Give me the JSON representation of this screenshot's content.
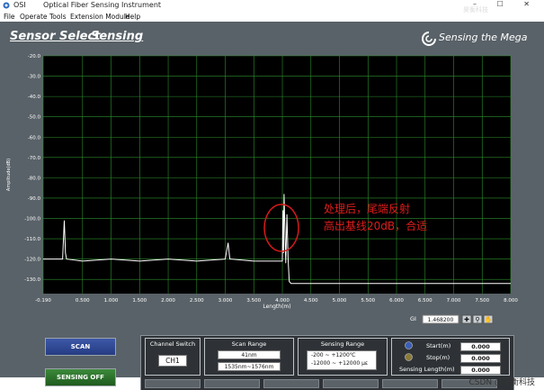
{
  "window": {
    "title_short": "OSI",
    "title": "Optical Fiber Sensing Instrument",
    "window_controls": "–  ☐  ✕"
  },
  "menu": [
    "File",
    "Operate",
    "Tools",
    "Extension Module",
    "Help"
  ],
  "nav": {
    "sensor_select": "Sensor Select",
    "sensing": "Sensing"
  },
  "brand": {
    "name": "Sensing the Mega"
  },
  "chart": {
    "ylabel": "Amplitude(dB)",
    "xlabel": "Length(m)",
    "annotation_line1": "处理后，尾端反射",
    "annotation_line2": "高出基线20dB，合适",
    "gi_label": "GI",
    "gi_value": "1.468200"
  },
  "chart_data": {
    "type": "line",
    "xlim": [
      -0.19,
      8.0
    ],
    "ylim": [
      -137.0,
      -20.0
    ],
    "x_ticks": [
      "-0.190",
      "0.500",
      "1.000",
      "1.500",
      "2.000",
      "2.500",
      "3.000",
      "3.500",
      "4.000",
      "4.500",
      "5.000",
      "5.500",
      "6.000",
      "6.500",
      "7.000",
      "7.500",
      "8.000"
    ],
    "y_ticks": [
      "-20.0",
      "-30.0",
      "-40.0",
      "-50.0",
      "-60.0",
      "-70.0",
      "-80.0",
      "-90.0",
      "-100.0",
      "-110.0",
      "-120.0",
      "-130.0"
    ],
    "grid": true,
    "series": [
      {
        "color": "#ffffff",
        "x": [
          -0.19,
          0.0,
          0.15,
          0.18,
          0.2,
          0.22,
          0.5,
          1.0,
          1.5,
          2.0,
          2.5,
          3.0,
          3.05,
          3.08,
          3.1,
          3.5,
          3.9,
          4.0,
          4.01,
          4.02,
          4.03,
          4.04,
          4.06,
          4.08,
          4.1,
          4.12,
          4.15,
          4.2,
          4.5,
          5.0,
          5.5,
          6.0,
          6.5,
          7.0,
          7.5,
          8.0
        ],
        "y": [
          -120,
          -120,
          -120,
          -101,
          -117,
          -120,
          -121,
          -120,
          -121,
          -120,
          -121,
          -120,
          -112,
          -120,
          -120,
          -121,
          -121,
          -121,
          -96,
          -117,
          -88,
          -100,
          -122,
          -98,
          -120,
          -131,
          -132,
          -132,
          -132,
          -132,
          -132,
          -132,
          -132,
          -132,
          -132,
          -132
        ]
      }
    ]
  },
  "controls": {
    "scan": "SCAN",
    "sensing_off": "SENSING OFF",
    "channel_switch_label": "Channel Switch",
    "channel_value": "CH1",
    "scan_range_label": "Scan Range",
    "scan_range_width": "41nm",
    "scan_range_span": "1535nm~1576nm",
    "sensing_range_label": "Sensing  Range",
    "sensing_range_temp": "-200 ~ +1200℃",
    "sensing_range_strain": "-12000 ~ +12000 με",
    "start_label": "Start(m)",
    "start_value": "0.000",
    "stop_label": "Stop(m)",
    "stop_value": "0.000",
    "length_label": "Sensing Length(m)",
    "length_value": "0.000"
  },
  "watermark": {
    "bottom": "CSDN @昊衡科技",
    "top": "昊衡科技"
  },
  "colors": {
    "background": "#596268",
    "plot_background": "#000000",
    "grid": "#2d8f2d",
    "trace": "#ffffff",
    "annotation": "#d81a1a",
    "scan_button": "#2f4892",
    "sensing_button": "#2f772d"
  }
}
